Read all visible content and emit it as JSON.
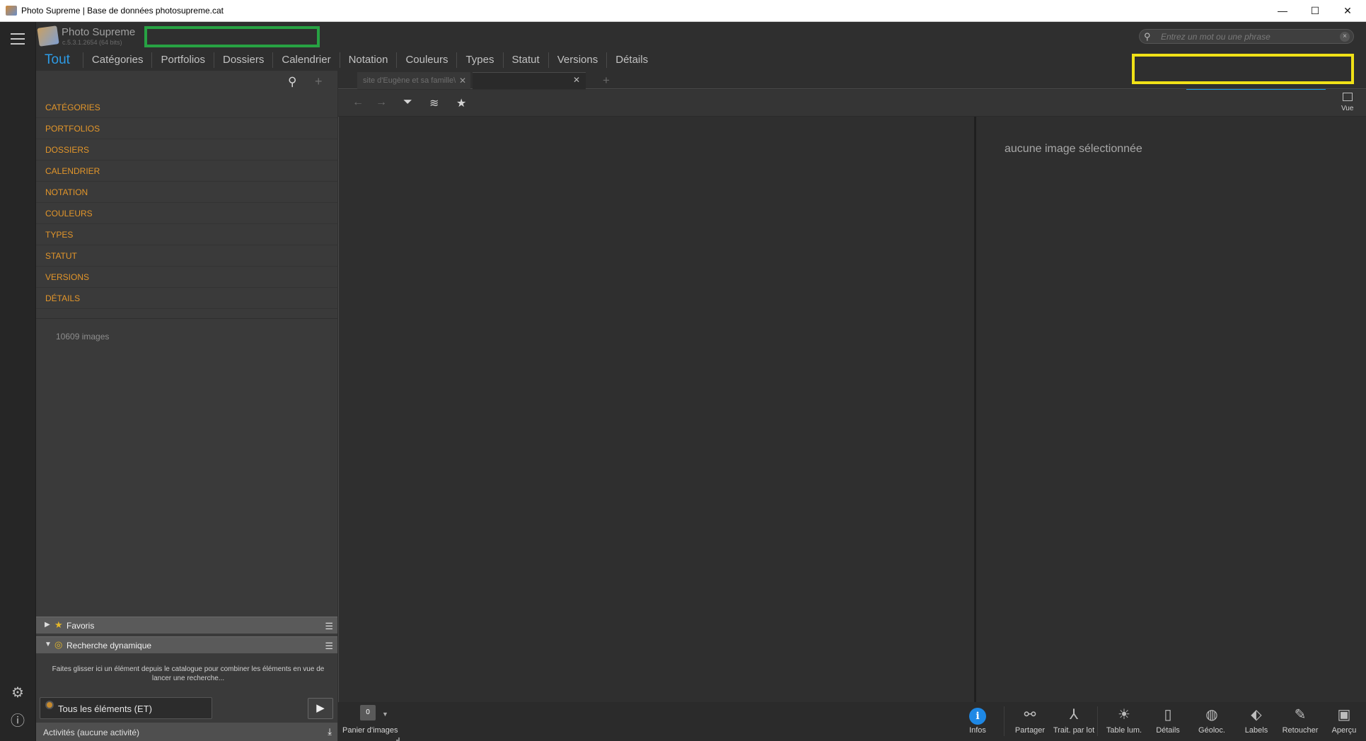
{
  "window": {
    "title": "Photo Supreme | Base de données photosupreme.cat",
    "controls": {
      "minimize": "—",
      "maximize": "☐",
      "close": "✕"
    }
  },
  "app": {
    "name": "Photo Supreme",
    "version": "c.5.3.1.2654 (64 bits)"
  },
  "tabs": [
    "Tout",
    "Catégories",
    "Portfolios",
    "Dossiers",
    "Calendrier",
    "Notation",
    "Couleurs",
    "Types",
    "Statut",
    "Versions",
    "Détails"
  ],
  "search": {
    "placeholder": "Entrez un mot ou une phrase",
    "icon": "magnifier-icon",
    "clear": "×"
  },
  "panel": {
    "categories": [
      "CATÉGORIES",
      "PORTFOLIOS",
      "DOSSIERS",
      "CALENDRIER",
      "NOTATION",
      "COULEURS",
      "TYPES",
      "STATUT",
      "VERSIONS",
      "DÉTAILS"
    ],
    "count": "10609 images",
    "favorites": "Favoris",
    "dynamic_search": "Recherche dynamique",
    "drop_hint": "Faites glisser ici un élément depuis le catalogue pour combiner les éléments en vue de lancer une recherche...",
    "all_items": "Tous les éléments (ET)",
    "activities": "Activités (aucune activité)"
  },
  "doc_tabs": {
    "tab1": "site d'Eugène et sa famille\\",
    "tab2": ""
  },
  "toolbar": {
    "vue": "Vue"
  },
  "inspector": {
    "empty": "aucune image sélectionnée"
  },
  "basket": {
    "count": "0",
    "label": "Panier d'images"
  },
  "bottom_buttons": [
    "Infos",
    "Partager",
    "Trait. par lot",
    "Table lum.",
    "Détails",
    "Géoloc.",
    "Labels",
    "Retoucher",
    "Aperçu"
  ],
  "highlight_colors": {
    "green": "#27a243",
    "yellow": "#f0e117",
    "blue": "#1e9fe3"
  },
  "accent_color": "#2d9be6",
  "category_color": "#e3962a"
}
